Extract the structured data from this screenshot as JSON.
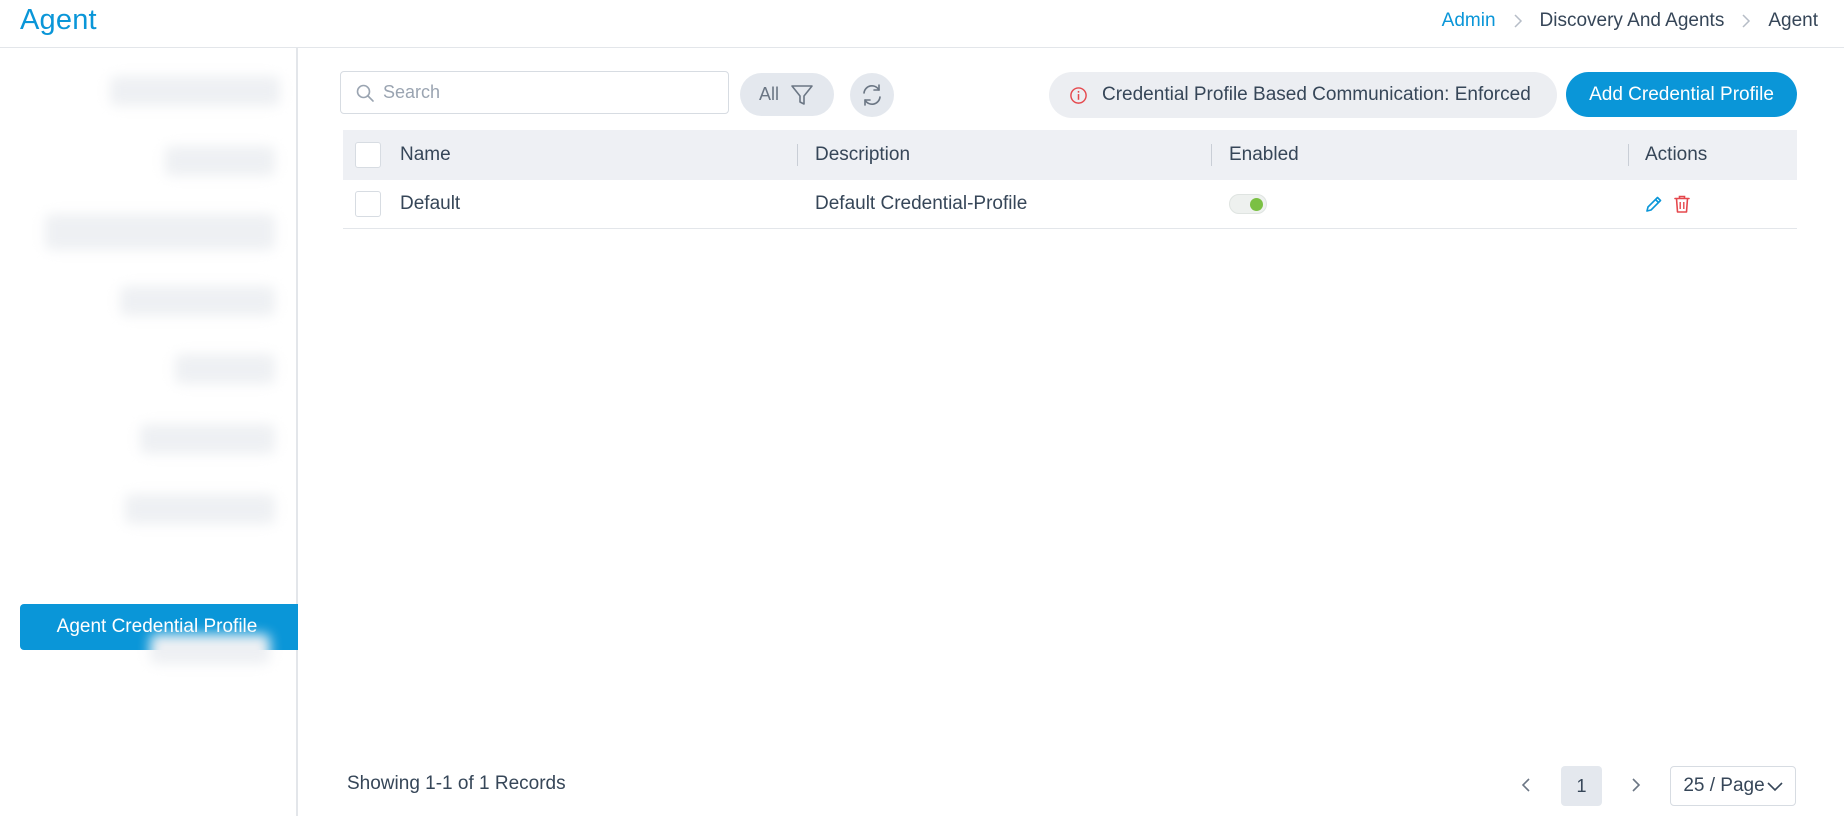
{
  "header": {
    "title": "Agent",
    "breadcrumb": [
      "Admin",
      "Discovery And Agents",
      "Agent"
    ]
  },
  "sidebar": {
    "active_item": "Agent Credential Profile"
  },
  "toolbar": {
    "search_placeholder": "Search",
    "filter_label": "All",
    "enforced_text": "Credential Profile Based Communication: Enforced",
    "add_label": "Add Credential Profile"
  },
  "table": {
    "columns": [
      "Name",
      "Description",
      "Enabled",
      "Actions"
    ],
    "rows": [
      {
        "name": "Default",
        "description": "Default Credential-Profile",
        "enabled": true
      }
    ]
  },
  "footer": {
    "showing": "Showing 1-1 of 1 Records",
    "current_page": "1",
    "page_size": "25 / Page"
  },
  "colors": {
    "accent": "#0a96d8",
    "toggle_on": "#7bc043",
    "delete": "#e5484d"
  }
}
